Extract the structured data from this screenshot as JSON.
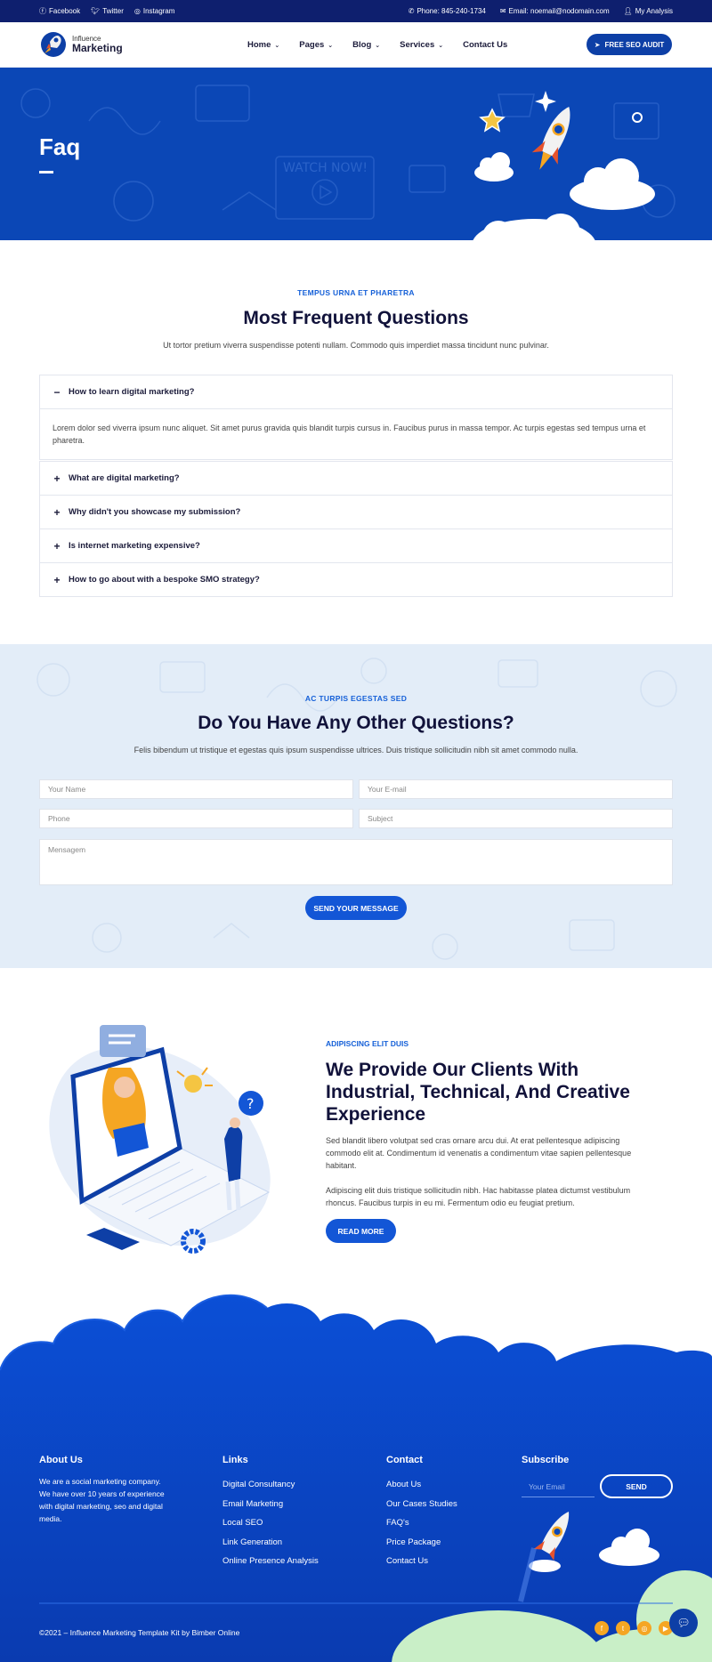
{
  "topbar": {
    "social": [
      {
        "icon": "facebook-icon",
        "label": "Facebook"
      },
      {
        "icon": "twitter-icon",
        "label": "Twitter"
      },
      {
        "icon": "instagram-icon",
        "label": "Instagram"
      }
    ],
    "phone": "Phone: 845-240-1734",
    "email": "Email: noemail@nodomain.com",
    "account": "My Analysis"
  },
  "header": {
    "logo_line1": "Influence",
    "logo_line2": "Marketing",
    "menu": [
      {
        "label": "Home",
        "has_dropdown": true
      },
      {
        "label": "Pages",
        "has_dropdown": true
      },
      {
        "label": "Blog",
        "has_dropdown": true
      },
      {
        "label": "Services",
        "has_dropdown": true
      },
      {
        "label": "Contact Us",
        "has_dropdown": false
      }
    ],
    "cta_label": "FREE SEO AUDIT"
  },
  "hero": {
    "title": "Faq"
  },
  "faq": {
    "eyebrow": "TEMPUS URNA ET PHARETRA",
    "title": "Most Frequent Questions",
    "lead": "Ut tortor pretium viverra suspendisse potenti nullam. Commodo quis imperdiet massa tincidunt nunc pulvinar.",
    "items": [
      {
        "q": "How to learn digital marketing?",
        "expanded": true,
        "a": "Lorem dolor sed viverra ipsum nunc aliquet. Sit amet purus gravida quis blandit turpis cursus in. Faucibus purus in massa tempor. Ac turpis egestas sed tempus urna et pharetra."
      },
      {
        "q": "What are digital marketing?",
        "expanded": false
      },
      {
        "q": "Why didn't you showcase my submission?",
        "expanded": false
      },
      {
        "q": "Is internet marketing expensive?",
        "expanded": false
      },
      {
        "q": "How to go about with a bespoke SMO strategy?",
        "expanded": false
      }
    ]
  },
  "contact_form": {
    "eyebrow": "AC TURPIS EGESTAS SED",
    "title": "Do You Have Any Other Questions?",
    "lead": "Felis bibendum ut tristique et egestas quis ipsum suspendisse ultrices. Duis tristique sollicitudin nibh sit amet commodo nulla.",
    "name_placeholder": "Your Name",
    "email_placeholder": "Your E-mail",
    "phone_placeholder": "Phone",
    "subject_placeholder": "Subject",
    "message_placeholder": "Mensagem",
    "submit_label": "SEND YOUR MESSAGE"
  },
  "about": {
    "eyebrow": "ADIPISCING ELIT DUIS",
    "title": "We Provide Our Clients With Industrial, Technical, And Creative Experience",
    "p1": "Sed blandit libero volutpat sed cras ornare arcu dui. At erat pellentesque adipiscing commodo elit at. Condimentum id venenatis a condimentum vitae sapien pellentesque habitant.",
    "p2": "Adipiscing elit duis tristique sollicitudin nibh. Hac habitasse platea dictumst vestibulum rhoncus. Faucibus turpis in eu mi. Fermentum odio eu feugiat pretium.",
    "button_label": "READ MORE"
  },
  "footer": {
    "about_title": "About Us",
    "about_text": "We are a social marketing company. We have over 10 years of experience with digital marketing, seo and digital media.",
    "links_title": "Links",
    "links": [
      "Digital Consultancy",
      "Email Marketing",
      "Local SEO",
      "Link Generation",
      "Online Presence Analysis"
    ],
    "contact_title": "Contact",
    "contact_links": [
      "About Us",
      "Our Cases Studies",
      "FAQ's",
      "Price Package",
      "Contact Us"
    ],
    "subscribe_title": "Subscribe",
    "subscribe_placeholder": "Your Email",
    "subscribe_button": "SEND",
    "copyright": "©2021 – Influence Marketing Template Kit by Bimber Online",
    "social_icons": [
      "facebook-icon",
      "twitter-icon",
      "instagram-icon",
      "youtube-icon"
    ]
  },
  "colors": {
    "primary": "#0b47b6",
    "dark": "#0e1f6e",
    "accent": "#1356d6",
    "orange": "#f5a623",
    "light_bg": "#e3edf8"
  }
}
